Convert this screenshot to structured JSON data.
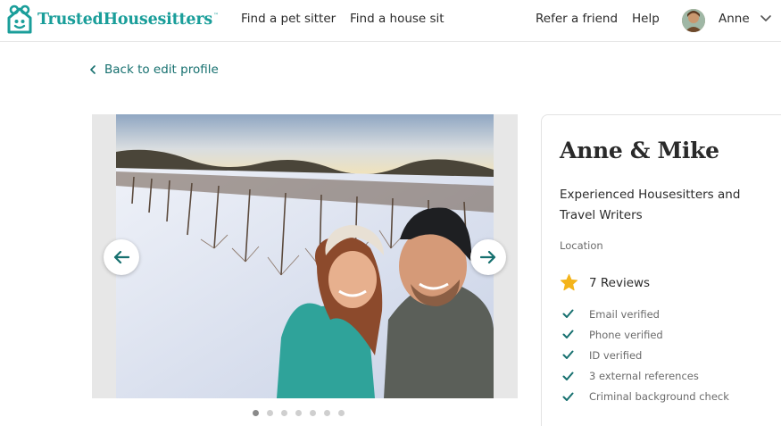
{
  "brand": {
    "name": "TrustedHousesitters",
    "tm": "™",
    "accent": "#1a9e9a"
  },
  "nav": {
    "find_sitter": "Find a pet sitter",
    "find_house_sit": "Find a house sit",
    "refer": "Refer a friend",
    "help": "Help",
    "user_name": "Anne"
  },
  "back": {
    "label": "Back to edit profile"
  },
  "gallery": {
    "prev_icon": "arrow-left-icon",
    "next_icon": "arrow-right-icon",
    "current_index": 1,
    "total": 7
  },
  "profile": {
    "name": "Anne & Mike",
    "tagline": "Experienced Housesitters and Travel Writers",
    "location_label": "Location",
    "reviews": "7 Reviews",
    "verifications": [
      "Email verified",
      "Phone verified",
      "ID verified",
      "3 external references",
      "Criminal background check"
    ]
  }
}
